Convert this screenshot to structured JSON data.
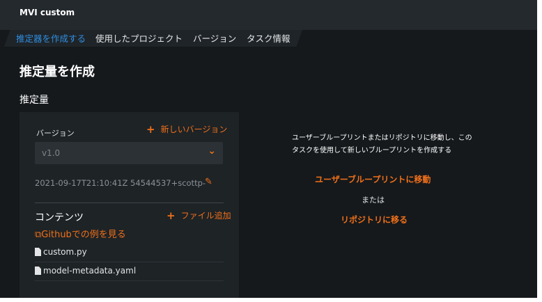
{
  "app": {
    "title": "MVI custom"
  },
  "tabs": [
    {
      "label": "推定器を作成する"
    },
    {
      "label": "使用したプロジェクト"
    },
    {
      "label": "バージョン"
    },
    {
      "label": "タスク情報"
    }
  ],
  "page": {
    "title": "推定量を作成",
    "section_title": "推定量"
  },
  "version": {
    "label": "バージョン",
    "new_version_label": "新しいバージョン",
    "selected": "v1.0",
    "meta": "2021-09-17T21:10:41Z 54544537+scottp-"
  },
  "contents": {
    "title": "コンテンツ",
    "add_file_label": "ファイル追加",
    "github_link": "Githubでの例を見る",
    "files": [
      "custom.py",
      "model-metadata.yaml"
    ]
  },
  "right": {
    "description_line1": "ユーザーブループリントまたはリポジトリに移動し、この",
    "description_line2": "タスクを使用して新しいブループリントを作成する",
    "go_user_blueprint": "ユーザーブループリントに移動",
    "or": "または",
    "go_repository": "リポジトリに移る"
  },
  "colors": {
    "accent": "#f0701a",
    "active_tab": "#2f8ee0",
    "background": "#15191c"
  },
  "icons": [
    "plus-icon",
    "chevron-down-icon",
    "pencil-icon",
    "external-link-icon",
    "file-icon"
  ]
}
